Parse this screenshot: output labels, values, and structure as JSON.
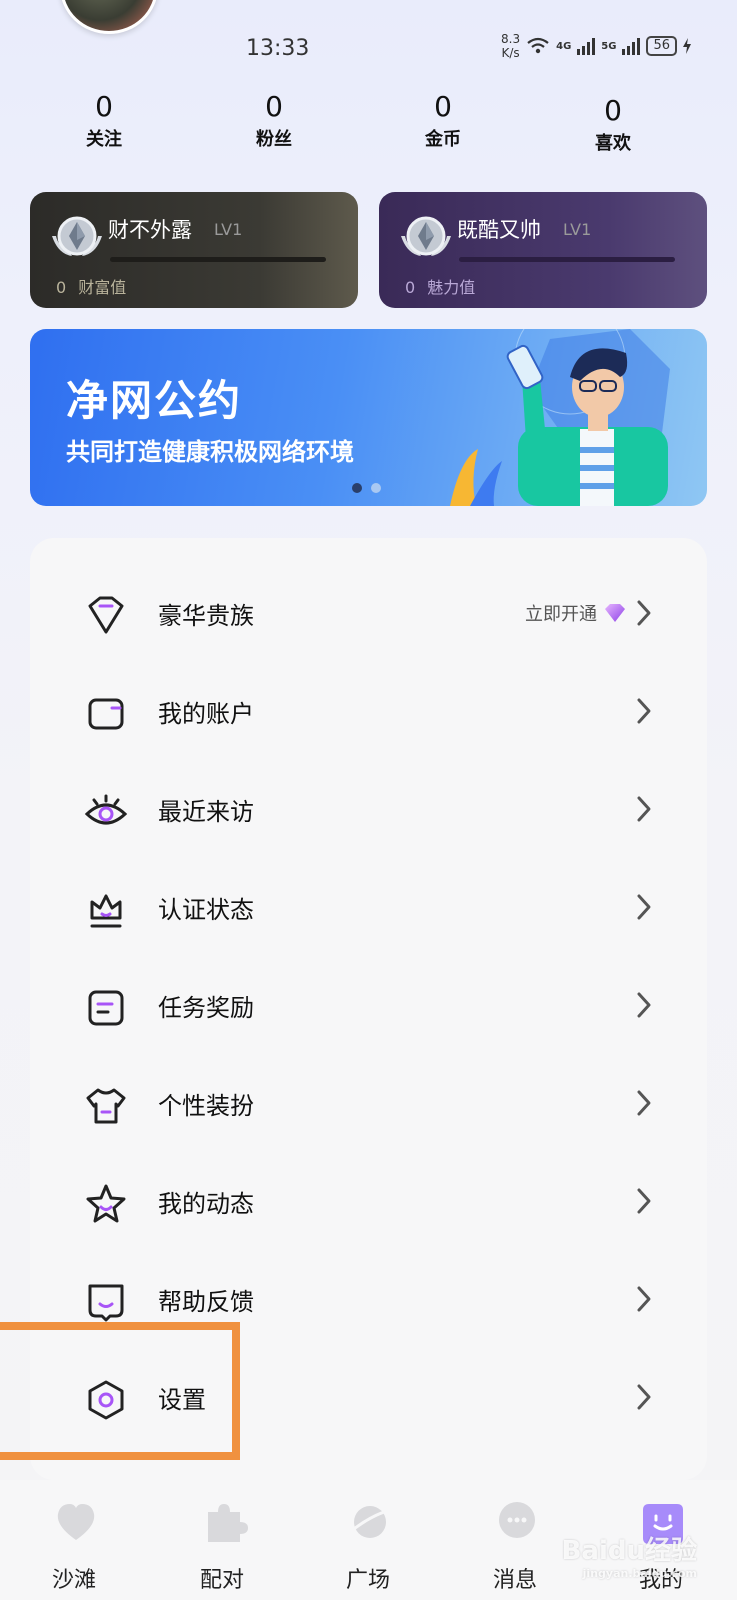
{
  "status": {
    "time": "13:33",
    "net_speed_top": "8.3",
    "net_speed_bottom": "K/s",
    "signal1": "4G",
    "signal2": "5G",
    "battery": "56"
  },
  "stats": [
    {
      "value": "0",
      "label": "关注"
    },
    {
      "value": "0",
      "label": "粉丝"
    },
    {
      "value": "0",
      "label": "金币"
    },
    {
      "value": "0",
      "label": "喜欢"
    }
  ],
  "level_cards": {
    "wealth": {
      "title": "财不外露",
      "level": "LV1",
      "value": "0",
      "value_label": "财富值"
    },
    "charm": {
      "title": "既酷又帅",
      "level": "LV1",
      "value": "0",
      "value_label": "魅力值"
    }
  },
  "banner": {
    "title": "净网公约",
    "subtitle": "共同打造健康积极网络环境",
    "pages": 2,
    "active_page": 1
  },
  "menu": [
    {
      "label": "豪华贵族",
      "icon": "diamond-outline-icon",
      "right_text": "立即开通"
    },
    {
      "label": "我的账户",
      "icon": "wallet-icon"
    },
    {
      "label": "最近来访",
      "icon": "eye-icon"
    },
    {
      "label": "认证状态",
      "icon": "crown-icon"
    },
    {
      "label": "任务奖励",
      "icon": "task-list-icon"
    },
    {
      "label": "个性装扮",
      "icon": "tshirt-icon"
    },
    {
      "label": "我的动态",
      "icon": "star-icon"
    },
    {
      "label": "帮助反馈",
      "icon": "feedback-icon"
    },
    {
      "label": "设置",
      "icon": "settings-hexagon-icon"
    }
  ],
  "tabs": [
    {
      "label": "沙滩",
      "icon": "heart-icon"
    },
    {
      "label": "配对",
      "icon": "puzzle-icon"
    },
    {
      "label": "广场",
      "icon": "planet-icon"
    },
    {
      "label": "消息",
      "icon": "chat-icon"
    },
    {
      "label": "我的",
      "icon": "profile-icon",
      "active": true
    }
  ],
  "watermark": {
    "text": "Baidu经验",
    "sub": "jingyan.baidu.com"
  },
  "colors": {
    "accent": "#8b5cf6",
    "highlight_box": "#f0913f"
  }
}
